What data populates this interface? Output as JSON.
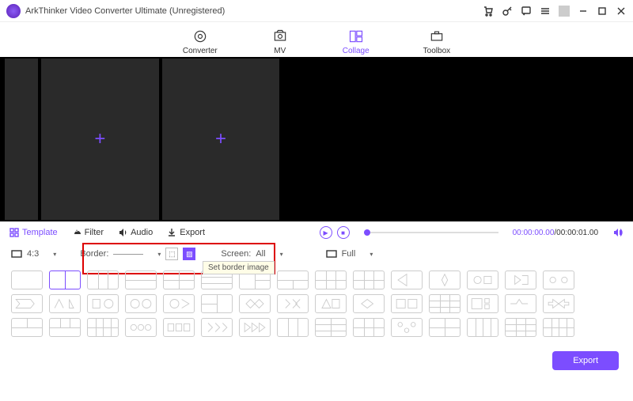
{
  "app": {
    "title": "ArkThinker Video Converter Ultimate (Unregistered)"
  },
  "nav": {
    "converter": "Converter",
    "mv": "MV",
    "collage": "Collage",
    "toolbox": "Toolbox"
  },
  "subnav": {
    "template": "Template",
    "filter": "Filter",
    "audio": "Audio",
    "export": "Export"
  },
  "time": {
    "current": "00:00:00.00",
    "total": "00:00:01.00",
    "sep": "/"
  },
  "opts": {
    "ratio": "4:3",
    "border_label": "Border:",
    "screen_label": "Screen:",
    "screen_val": "All",
    "full_label": "Full",
    "tooltip": "Set border image"
  },
  "footer": {
    "export": "Export"
  }
}
